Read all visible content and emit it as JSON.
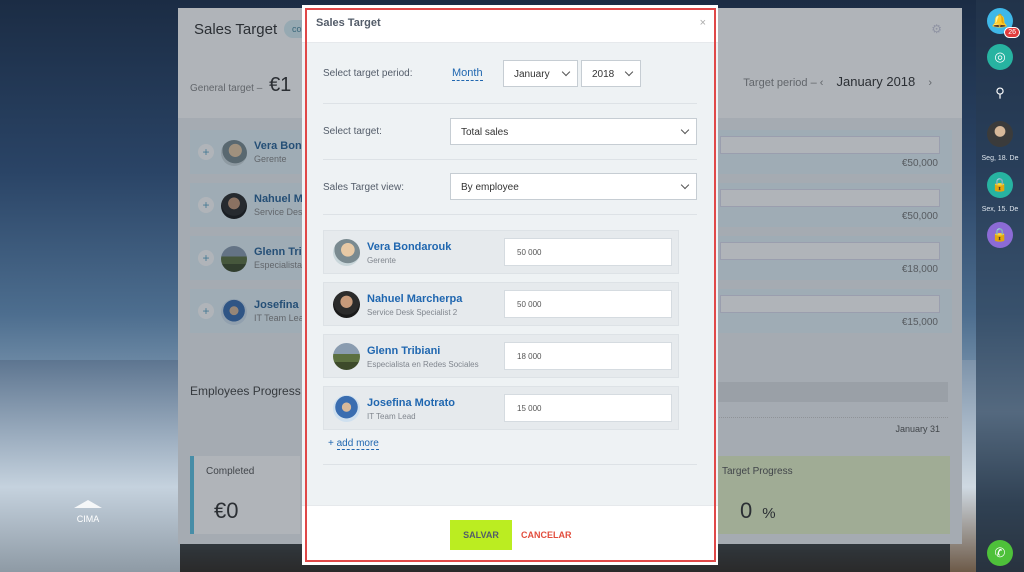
{
  "background": {
    "scroll_top_label": "CIMA"
  },
  "right_rail": {
    "notifications_count": "26",
    "date1": "Seg, 18. De",
    "date2": "Sex, 15. De"
  },
  "page": {
    "title": "Sales Target",
    "chip": "co",
    "general_target_label": "General target",
    "general_target_value": "€1",
    "target_period_label": "Target period",
    "target_period_value": "January 2018",
    "employees": [
      {
        "name": "Vera Bon",
        "role": "Gerente",
        "amount": "€50,000"
      },
      {
        "name": "Nahuel M",
        "role": "Service Des",
        "amount": "€50,000"
      },
      {
        "name": "Glenn Tri",
        "role": "Especialista",
        "amount": "€18,000"
      },
      {
        "name": "Josefina N",
        "role": "IT Team Lea",
        "amount": "€15,000"
      }
    ],
    "employees_progress_label": "Employees Progress",
    "progress_end_label": "January 31",
    "completed_label": "Completed",
    "completed_value": "€0",
    "target_progress_label": "Target Progress",
    "target_progress_value": "0",
    "target_progress_unit": "%"
  },
  "modal": {
    "title": "Sales Target",
    "close": "×",
    "period_label": "Select target period:",
    "period_type": "Month",
    "month_value": "January",
    "year_value": "2018",
    "target_label": "Select target:",
    "target_value": "Total sales",
    "view_label": "Sales Target view:",
    "view_value": "By employee",
    "employees": [
      {
        "name": "Vera Bondarouk",
        "role": "Gerente",
        "target": "50 000"
      },
      {
        "name": "Nahuel Marcherpa",
        "role": "Service Desk Specialist 2",
        "target": "50 000"
      },
      {
        "name": "Glenn Tribiani",
        "role": "Especialista en Redes Sociales",
        "target": "18 000"
      },
      {
        "name": "Josefina Motrato",
        "role": "IT Team Lead",
        "target": "15 000"
      }
    ],
    "add_more": "add more",
    "save": "SALVAR",
    "cancel": "CANCELAR"
  }
}
